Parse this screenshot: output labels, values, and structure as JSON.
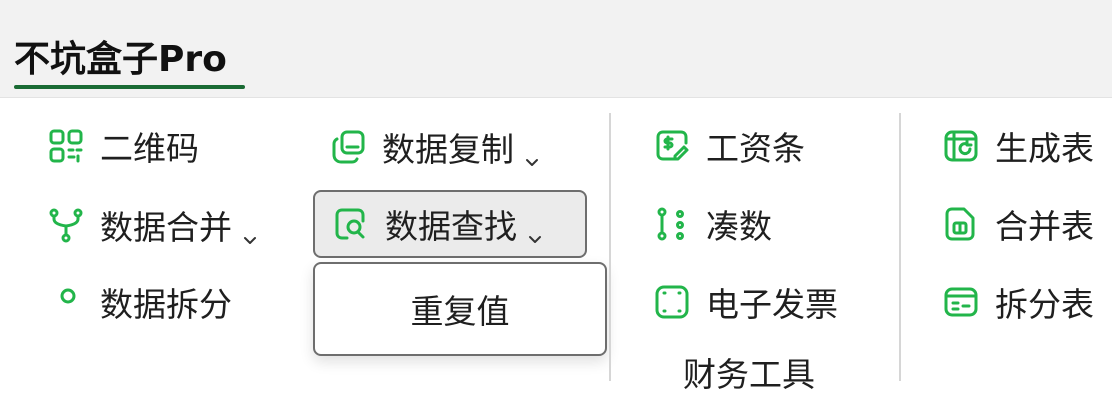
{
  "tab": {
    "label": "不坑盒子Pro"
  },
  "colors": {
    "accent": "#22b54a",
    "tab_underline": "#1a6b34"
  },
  "groups": {
    "data": {
      "items": [
        {
          "label": "二维码",
          "icon": "qr-code-icon"
        },
        {
          "label": "数据复制",
          "icon": "copy-icon",
          "dropdown": true
        },
        {
          "label": "数据合并",
          "icon": "merge-icon",
          "dropdown": true
        },
        {
          "label": "数据查找",
          "icon": "search-doc-icon",
          "dropdown": true,
          "active": true
        },
        {
          "label": "数据拆分",
          "icon": "split-icon"
        }
      ],
      "menu": {
        "items": [
          "重复值"
        ]
      }
    },
    "finance": {
      "label": "财务工具",
      "items": [
        {
          "label": "工资条",
          "icon": "payslip-icon"
        },
        {
          "label": "凑数",
          "icon": "numbers-icon"
        },
        {
          "label": "电子发票",
          "icon": "invoice-icon"
        }
      ]
    },
    "table": {
      "items": [
        {
          "label": "生成表",
          "icon": "generate-table-icon"
        },
        {
          "label": "合并表",
          "icon": "merge-table-icon"
        },
        {
          "label": "拆分表",
          "icon": "split-table-icon"
        }
      ]
    }
  }
}
